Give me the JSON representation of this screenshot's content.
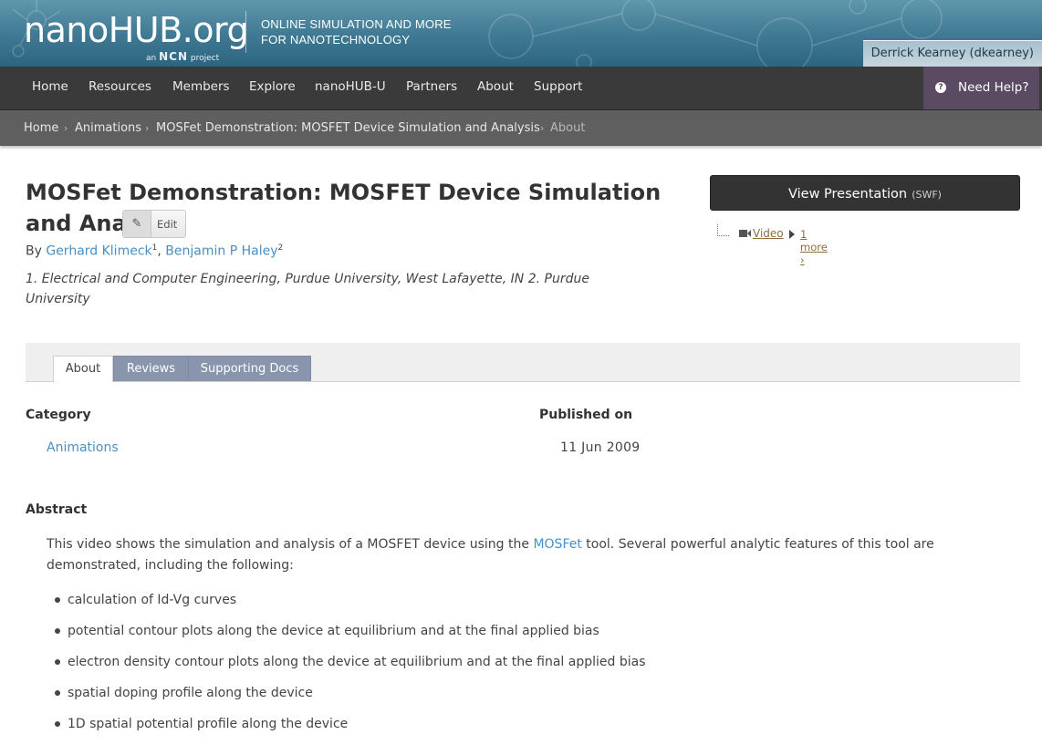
{
  "header": {
    "logo": "nanoHUB.org",
    "logo_sub_prefix": "an",
    "logo_sub_brand": "NCN",
    "logo_sub_suffix": "project",
    "tagline_1": "ONLINE SIMULATION AND MORE",
    "tagline_2": "FOR NANOTECHNOLOGY",
    "user": "Derrick Kearney (dkearney)"
  },
  "nav": {
    "items": [
      "Home",
      "Resources",
      "Members",
      "Explore",
      "nanoHUB-U",
      "Partners",
      "About",
      "Support"
    ],
    "help_icon": "question-icon",
    "help_label": "Need Help?"
  },
  "breadcrumb": {
    "items": [
      "Home",
      "Animations",
      "MOSFet Demonstration: MOSFET Device Simulation and Analysis"
    ],
    "current": "About"
  },
  "resource": {
    "title": "MOSFet Demonstration: MOSFET Device Simulation and Analysis",
    "edit_label": "Edit",
    "by": "By",
    "authors": [
      {
        "name": "Gerhard Klimeck",
        "sup": "1"
      },
      {
        "name": "Benjamin P Haley",
        "sup": "2"
      }
    ],
    "affiliations": "1. Electrical and Computer Engineering, Purdue University, West Lafayette, IN 2. Purdue University"
  },
  "presentation": {
    "button_label": "View Presentation",
    "format": "(SWF)",
    "video_label": "Video",
    "more_label": "1 more ›"
  },
  "tabs": [
    "About",
    "Reviews",
    "Supporting Docs"
  ],
  "meta": {
    "category_label": "Category",
    "category_value": "Animations",
    "published_label": "Published on",
    "published_value": "11 Jun 2009"
  },
  "abstract": {
    "label": "Abstract",
    "text_before": "This video shows the simulation and analysis of a MOSFET device using the ",
    "link": "MOSFet",
    "text_after": " tool. Several powerful analytic features of this tool are demonstrated, including the following:",
    "bullets": [
      "calculation of Id-Vg curves",
      "potential contour plots along the device at equilibrium and at the final applied bias",
      "electron density contour plots along the device at equilibrium and at the final applied bias",
      "spatial doping profile along the device",
      "1D spatial potential profile along the device"
    ]
  },
  "colors": {
    "nav_bg": "#3a3a3a",
    "help_bg": "#5a4b63",
    "link": "#4a8fc4",
    "tab_inactive": "#8995ad"
  }
}
